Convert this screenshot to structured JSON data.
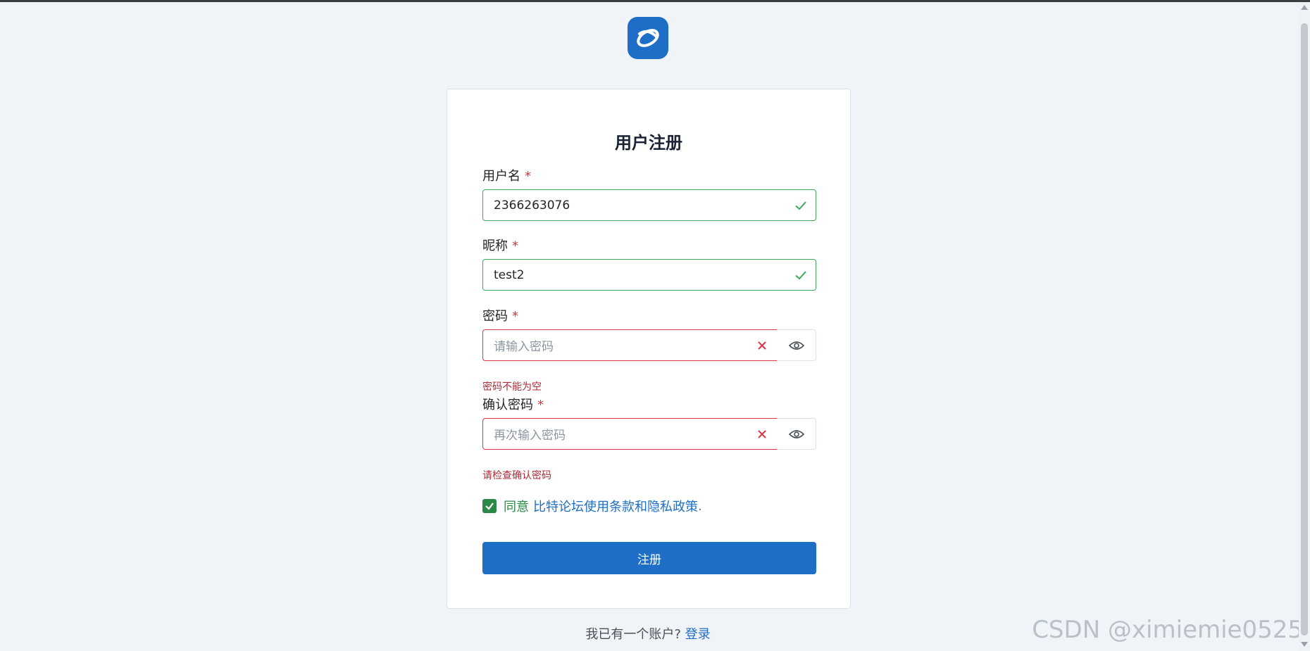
{
  "logo": {
    "icon": "bitforum-logo-icon",
    "color": "#1e6ec8"
  },
  "form": {
    "title": "用户注册",
    "username": {
      "label": "用户名",
      "required_mark": "*",
      "value": "2366263076",
      "state": "valid"
    },
    "nickname": {
      "label": "昵称",
      "required_mark": "*",
      "value": "test2",
      "state": "valid"
    },
    "password": {
      "label": "密码",
      "required_mark": "*",
      "placeholder": "请输入密码",
      "error": "密码不能为空"
    },
    "confirm_password": {
      "label": "确认密码",
      "required_mark": "*",
      "placeholder": "再次输入密码",
      "error": "请检查确认密码"
    },
    "agree": {
      "checked": true,
      "word": "同意",
      "link_text": "比特论坛使用条款和隐私政策",
      "suffix": "."
    },
    "submit_label": "注册"
  },
  "footer": {
    "text": "我已有一个账户?",
    "login_link": "登录"
  },
  "watermark": "CSDN @ximiemie0525",
  "colors": {
    "primary": "#1e6ec8",
    "success": "#3ea85a",
    "danger": "#dc3545",
    "background": "#f0f4f9"
  }
}
